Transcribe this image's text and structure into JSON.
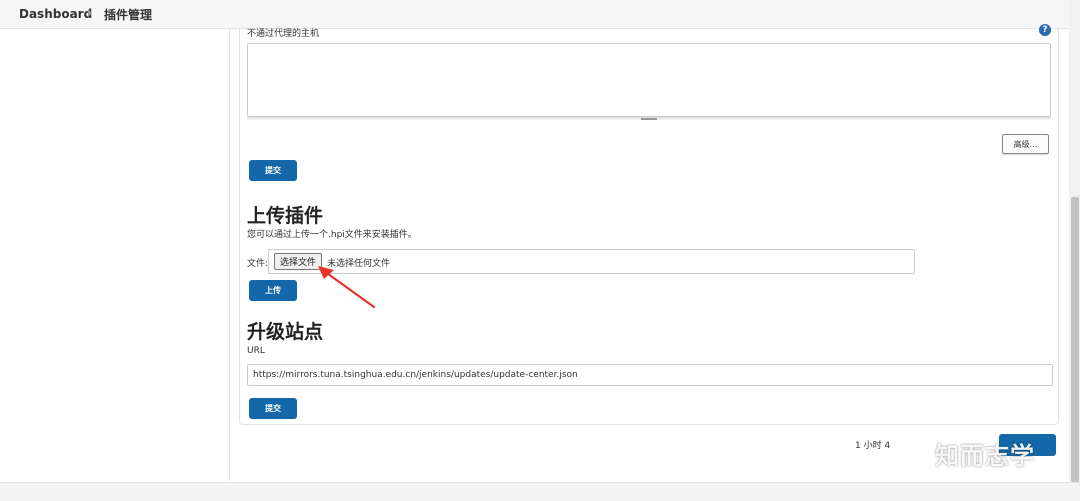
{
  "breadcrumb": {
    "home": "Dashboard",
    "current": "插件管理"
  },
  "proxy": {
    "no_proxy_label": "不通过代理的主机",
    "help_icon": "question-icon",
    "help_glyph": "?",
    "no_proxy_value": "",
    "advanced_label": "高级...",
    "submit_label": "提交"
  },
  "upload": {
    "title": "上传插件",
    "description": "您可以通过上传一个.hpi文件来安装插件。",
    "file_label": "文件:",
    "choose_file_label": "选择文件",
    "no_file_text": "未选择任何文件",
    "upload_label": "上传"
  },
  "update_site": {
    "title": "升级站点",
    "url_label": "URL",
    "url_value": "https://mirrors.tuna.tsinghua.edu.cn/jenkins/updates/update-center.json",
    "submit_label": "提交"
  },
  "status": {
    "last_checked_text": "1 小时 4"
  },
  "watermark": {
    "text": "知而志学",
    "logo_icon": "wechat-logo-icon"
  },
  "colors": {
    "primary_button": "#1467a8",
    "annotation_arrow": "#e8322b",
    "help_icon": "#2b6aad"
  }
}
